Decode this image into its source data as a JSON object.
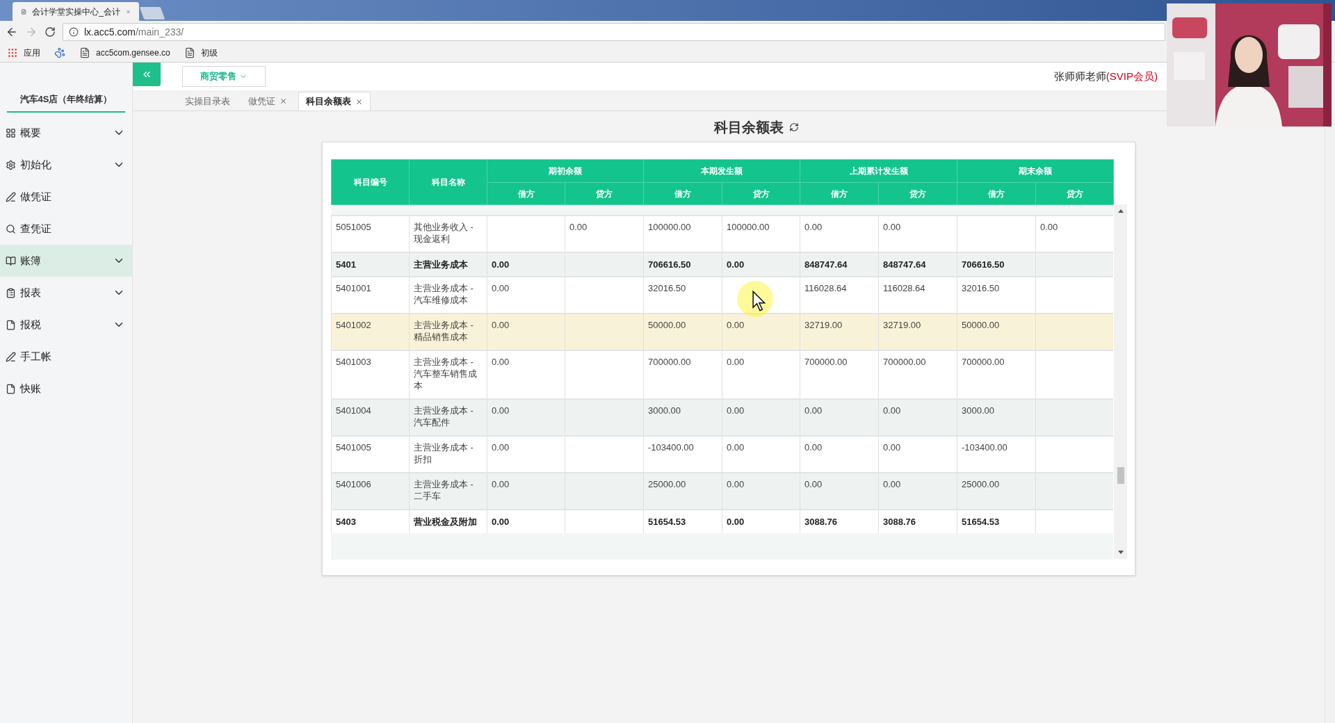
{
  "browser": {
    "tab_title": "会计学堂实操中心_会计",
    "url_host": "lx.acc5.com",
    "url_path": "/main_233/",
    "bookmarks": [
      {
        "kind": "apps",
        "label": "应用"
      },
      {
        "kind": "paw"
      },
      {
        "kind": "page",
        "label": "acc5com.gensee.co"
      },
      {
        "kind": "page",
        "label": "初级"
      }
    ]
  },
  "sidebar": {
    "company": "汽车4S店（年终结算）",
    "items": [
      {
        "kind": "grid",
        "label": "概要",
        "expandable": true,
        "selected": false
      },
      {
        "kind": "gear",
        "label": "初始化",
        "expandable": true,
        "selected": false
      },
      {
        "kind": "pen",
        "label": "做凭证",
        "expandable": false,
        "selected": false
      },
      {
        "kind": "search",
        "label": "查凭证",
        "expandable": false,
        "selected": false
      },
      {
        "kind": "book",
        "label": "账簿",
        "expandable": true,
        "selected": true
      },
      {
        "kind": "list",
        "label": "报表",
        "expandable": true,
        "selected": false
      },
      {
        "kind": "file",
        "label": "报税",
        "expandable": true,
        "selected": false
      },
      {
        "kind": "pen",
        "label": "手工帐",
        "expandable": false,
        "selected": false
      },
      {
        "kind": "file",
        "label": "快账",
        "expandable": false,
        "selected": false
      }
    ]
  },
  "toolbar": {
    "industry": "商贸零售",
    "user": "张师师老师",
    "membership": "(SVIP会员)"
  },
  "tabs": [
    {
      "label": "实操目录表",
      "closable": false,
      "selected": false
    },
    {
      "label": "做凭证",
      "closable": true,
      "selected": false
    },
    {
      "label": "科目余额表",
      "closable": true,
      "selected": true
    }
  ],
  "page_title": "科目余额表",
  "table": {
    "columns": [
      "科目编号",
      "科目名称"
    ],
    "groups": [
      {
        "label": "期初余额",
        "subcolumns": [
          "借方",
          "贷方"
        ]
      },
      {
        "label": "本期发生额",
        "subcolumns": [
          "借方",
          "贷方"
        ]
      },
      {
        "label": "上期累计发生额",
        "subcolumns": [
          "借方",
          "贷方"
        ]
      },
      {
        "label": "期末余额",
        "subcolumns": [
          "借方",
          "贷方"
        ]
      }
    ],
    "rows": [
      {
        "kind": "detail",
        "highlighted": false,
        "cells": [
          "5051005",
          "其他业务收入 - 现金返利",
          null,
          "0.00",
          "100000.00",
          "100000.00",
          "0.00",
          "0.00",
          null,
          "0.00"
        ]
      },
      {
        "kind": "total",
        "highlighted": false,
        "cells": [
          "5401",
          "主营业务成本",
          "0.00",
          null,
          "706616.50",
          "0.00",
          "848747.64",
          "848747.64",
          "706616.50",
          null
        ]
      },
      {
        "kind": "detail",
        "highlighted": false,
        "cells": [
          "5401001",
          "主营业务成本 - 汽车维修成本",
          "0.00",
          null,
          "32016.50",
          null,
          "116028.64",
          "116028.64",
          "32016.50",
          null
        ]
      },
      {
        "kind": "detail",
        "highlighted": true,
        "cells": [
          "5401002",
          "主营业务成本 - 精品销售成本",
          "0.00",
          null,
          "50000.00",
          "0.00",
          "32719.00",
          "32719.00",
          "50000.00",
          null
        ]
      },
      {
        "kind": "detail",
        "highlighted": false,
        "cells": [
          "5401003",
          "主营业务成本 - 汽车整车销售成本",
          "0.00",
          null,
          "700000.00",
          "0.00",
          "700000.00",
          "700000.00",
          "700000.00",
          null
        ]
      },
      {
        "kind": "detail",
        "highlighted": false,
        "cells": [
          "5401004",
          "主营业务成本 - 汽车配件",
          "0.00",
          null,
          "3000.00",
          "0.00",
          "0.00",
          "0.00",
          "3000.00",
          null
        ]
      },
      {
        "kind": "detail",
        "highlighted": false,
        "cells": [
          "5401005",
          "主营业务成本 - 折扣",
          "0.00",
          null,
          "-103400.00",
          "0.00",
          "0.00",
          "0.00",
          "-103400.00",
          null
        ]
      },
      {
        "kind": "detail",
        "highlighted": false,
        "cells": [
          "5401006",
          "主营业务成本 - 二手车",
          "0.00",
          null,
          "25000.00",
          "0.00",
          "0.00",
          "0.00",
          "25000.00",
          null
        ]
      },
      {
        "kind": "total",
        "highlighted": false,
        "cells": [
          "5403",
          "营业税金及附加",
          "0.00",
          null,
          "51654.53",
          "0.00",
          "3088.76",
          "3088.76",
          "51654.53",
          null
        ]
      }
    ]
  }
}
